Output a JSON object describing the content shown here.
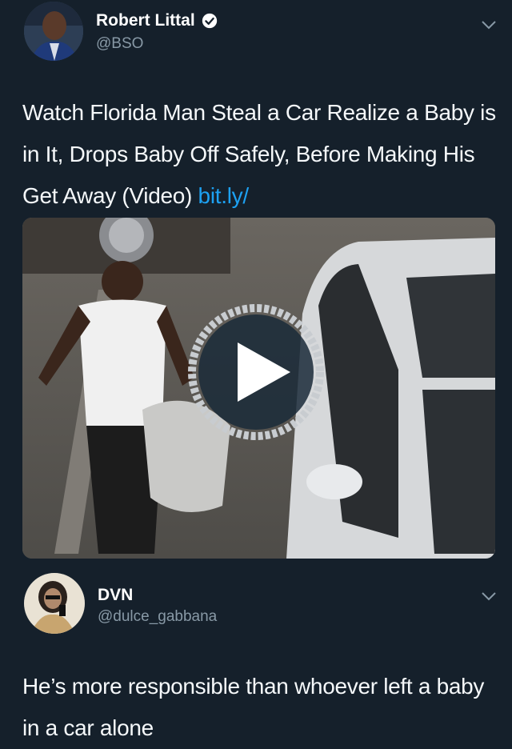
{
  "tweet1": {
    "display_name": "Robert Littal",
    "handle": "@BSO",
    "verified": true,
    "text": "Watch Florida Man Steal a Car Realize a Baby is in It, Drops Baby Off Safely, Before Making His Get Away (Video) ",
    "link_text": "bit.ly/"
  },
  "tweet2": {
    "display_name": "DVN",
    "handle": "@dulce_gabbana",
    "text": "He’s more responsible than whoever left a baby in a car alone"
  },
  "icons": {
    "verified": "verified-badge-icon",
    "menu": "chevron-down-icon",
    "play": "play-icon"
  },
  "colors": {
    "background": "#15202b",
    "link": "#1da1f2",
    "handle": "#8899a6",
    "text": "#f5f8fa"
  }
}
